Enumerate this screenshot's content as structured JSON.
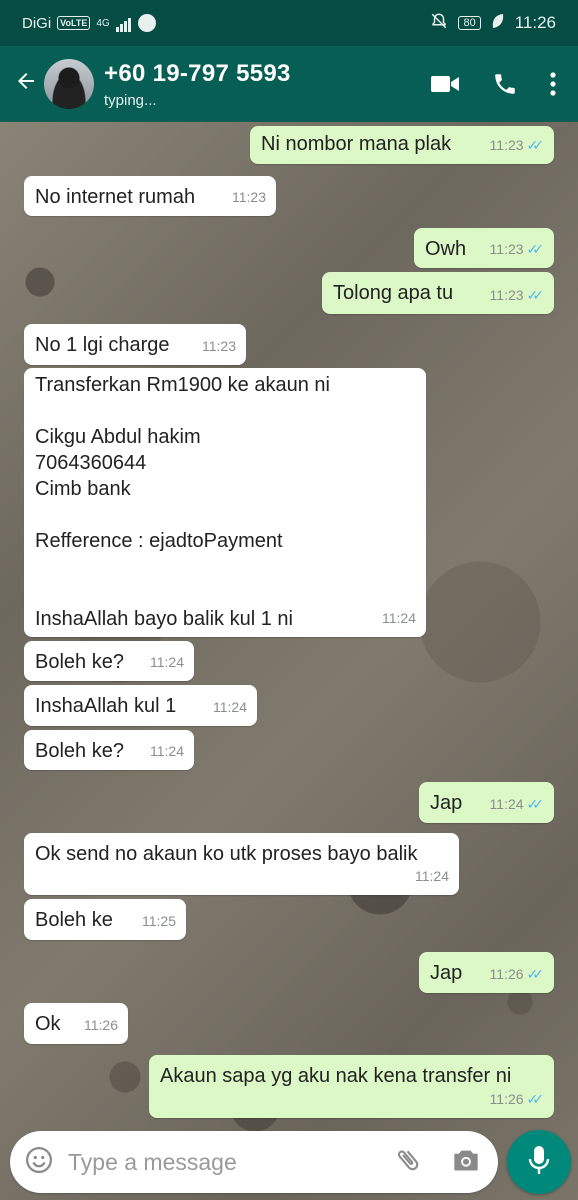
{
  "status_bar": {
    "carrier": "DiGi",
    "volte": "VoLTE",
    "network": "4G",
    "battery": "80",
    "time": "11:26"
  },
  "header": {
    "contact_name": "+60 19-797 5593",
    "contact_status": "typing...",
    "icons": [
      "back-arrow-icon",
      "video-call-icon",
      "phone-icon",
      "more-vert-icon"
    ]
  },
  "messages": [
    {
      "dir": "out",
      "text": "Ni nombor mana plak",
      "time": "11:23",
      "read": true
    },
    {
      "dir": "in",
      "text": "No internet rumah",
      "time": "11:23"
    },
    {
      "dir": "out",
      "text": "Owh",
      "time": "11:23",
      "read": true
    },
    {
      "dir": "out",
      "text": "Tolong apa tu",
      "time": "11:23",
      "read": true
    },
    {
      "dir": "in",
      "text": "No 1 lgi charge",
      "time": "11:23"
    },
    {
      "dir": "in",
      "text": "Transferkan Rm1900 ke akaun ni\n\nCikgu Abdul hakim\n7064360644\nCimb bank\n\nRefference : ejadtoPayment\n\n\nInshaAllah bayo balik kul 1 ni",
      "time": "11:24"
    },
    {
      "dir": "in",
      "text": "Boleh ke?",
      "time": "11:24"
    },
    {
      "dir": "in",
      "text": "InshaAllah kul 1",
      "time": "11:24"
    },
    {
      "dir": "in",
      "text": "Boleh ke?",
      "time": "11:24"
    },
    {
      "dir": "out",
      "text": "Jap",
      "time": "11:24",
      "read": true
    },
    {
      "dir": "in",
      "text": "Ok send no akaun ko utk proses bayo balik",
      "time": "11:24"
    },
    {
      "dir": "in",
      "text": "Boleh ke",
      "time": "11:25"
    },
    {
      "dir": "out",
      "text": "Jap",
      "time": "11:26",
      "read": true
    },
    {
      "dir": "in",
      "text": "Ok",
      "time": "11:26"
    },
    {
      "dir": "out",
      "text": "Akaun sapa yg aku nak kena transfer ni",
      "time": "11:26",
      "read": true
    }
  ],
  "composer": {
    "placeholder": "Type a message",
    "icons": [
      "emoji-icon",
      "attach-icon",
      "camera-icon",
      "mic-icon"
    ]
  },
  "colors": {
    "status_bar": "#054d44",
    "app_bar": "#075e54",
    "outgoing_bubble": "#dcf8c6",
    "incoming_bubble": "#ffffff",
    "read_ticks": "#4fb6ec",
    "mic_button": "#00897b"
  }
}
